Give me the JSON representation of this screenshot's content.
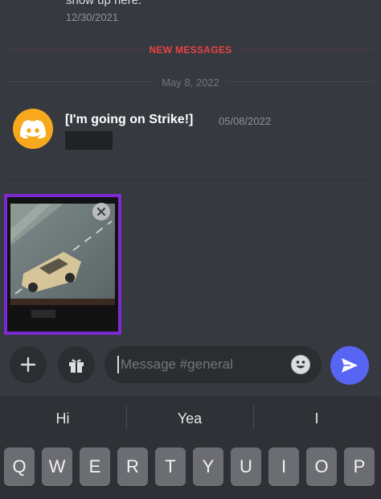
{
  "chat": {
    "previous_message_tail": "show up here.",
    "previous_message_date": "12/30/2021",
    "new_messages_label": "NEW MESSAGES",
    "date_divider": "May 8, 2022",
    "message": {
      "author": "[I'm going on Strike!]",
      "timestamp": "05/08/2022",
      "avatar_icon": "discord-logo-icon",
      "avatar_color": "#f6a91d"
    }
  },
  "attachment": {
    "highlight_color": "#7b2bd0",
    "remove_icon": "close-icon"
  },
  "composer": {
    "placeholder": "Message #general",
    "value": "",
    "accent_color": "#5865f2"
  },
  "suggestions": [
    "Hi",
    "Yea",
    "I"
  ],
  "keyboard": {
    "row1": [
      "Q",
      "W",
      "E",
      "R",
      "T",
      "Y",
      "U",
      "I",
      "O",
      "P"
    ]
  }
}
